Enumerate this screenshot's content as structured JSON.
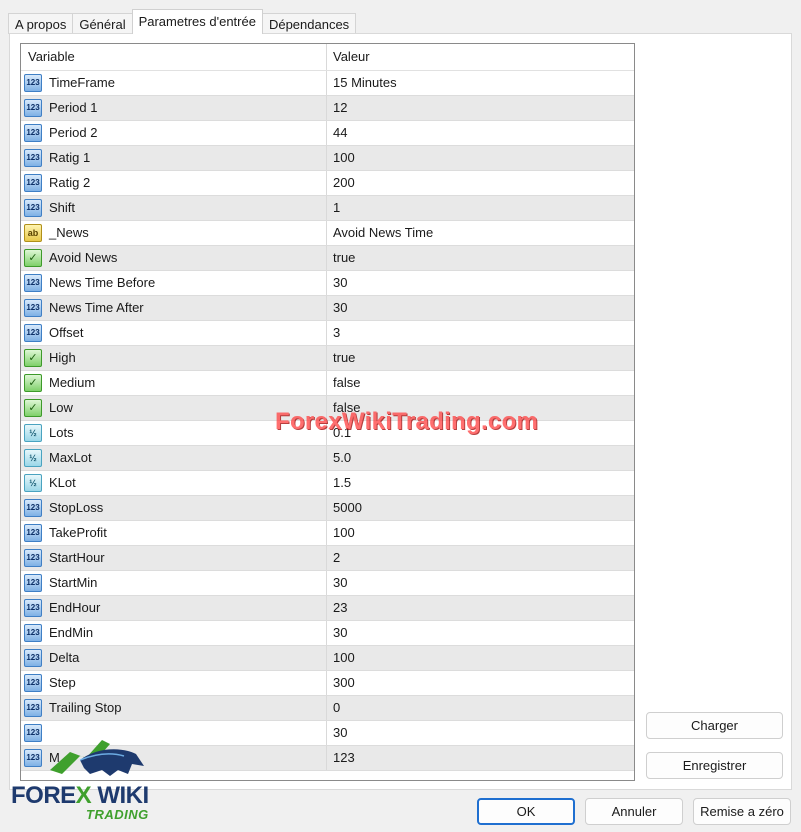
{
  "tabs": [
    {
      "label": "A propos"
    },
    {
      "label": "Général"
    },
    {
      "label": "Parametres d'entrée"
    },
    {
      "label": "Dépendances"
    }
  ],
  "grid": {
    "headers": {
      "variable": "Variable",
      "value": "Valeur"
    },
    "rows": [
      {
        "type": "int",
        "icon": "123",
        "name": "TimeFrame",
        "value": "15 Minutes"
      },
      {
        "type": "int",
        "icon": "123",
        "name": "Period 1",
        "value": "12"
      },
      {
        "type": "int",
        "icon": "123",
        "name": "Period 2",
        "value": "44"
      },
      {
        "type": "int",
        "icon": "123",
        "name": "Ratig 1",
        "value": "100"
      },
      {
        "type": "int",
        "icon": "123",
        "name": "Ratig 2",
        "value": "200"
      },
      {
        "type": "int",
        "icon": "123",
        "name": "Shift",
        "value": "1"
      },
      {
        "type": "str",
        "icon": "ab",
        "name": "_News",
        "value": "Avoid News Time"
      },
      {
        "type": "bool",
        "icon": "✓",
        "name": "Avoid News",
        "value": "true"
      },
      {
        "type": "int",
        "icon": "123",
        "name": "News Time Before",
        "value": "30"
      },
      {
        "type": "int",
        "icon": "123",
        "name": "News Time After",
        "value": "30"
      },
      {
        "type": "int",
        "icon": "123",
        "name": "Offset",
        "value": "3"
      },
      {
        "type": "bool",
        "icon": "✓",
        "name": "High",
        "value": "true"
      },
      {
        "type": "bool",
        "icon": "✓",
        "name": "Medium",
        "value": "false"
      },
      {
        "type": "bool",
        "icon": "✓",
        "name": "Low",
        "value": "false"
      },
      {
        "type": "dbl",
        "icon": "½",
        "name": "Lots",
        "value": "0.1"
      },
      {
        "type": "dbl",
        "icon": "½",
        "name": "MaxLot",
        "value": "5.0"
      },
      {
        "type": "dbl",
        "icon": "½",
        "name": "KLot",
        "value": "1.5"
      },
      {
        "type": "int",
        "icon": "123",
        "name": "StopLoss",
        "value": "5000"
      },
      {
        "type": "int",
        "icon": "123",
        "name": "TakeProfit",
        "value": "100"
      },
      {
        "type": "int",
        "icon": "123",
        "name": "StartHour",
        "value": "2"
      },
      {
        "type": "int",
        "icon": "123",
        "name": "StartMin",
        "value": "30"
      },
      {
        "type": "int",
        "icon": "123",
        "name": "EndHour",
        "value": "23"
      },
      {
        "type": "int",
        "icon": "123",
        "name": "EndMin",
        "value": "30"
      },
      {
        "type": "int",
        "icon": "123",
        "name": "Delta",
        "value": "100"
      },
      {
        "type": "int",
        "icon": "123",
        "name": "Step",
        "value": "300"
      },
      {
        "type": "int",
        "icon": "123",
        "name": "Trailing Stop",
        "value": "0"
      },
      {
        "type": "int",
        "icon": "123",
        "name": "",
        "value": "30"
      },
      {
        "type": "int",
        "icon": "123",
        "name": "M",
        "value": "123"
      }
    ]
  },
  "side_buttons": {
    "load": "Charger",
    "save": "Enregistrer"
  },
  "footer_buttons": {
    "ok": "OK",
    "cancel": "Annuler",
    "reset": "Remise a zéro"
  },
  "watermark": {
    "text": "ForexWikiTrading.com"
  },
  "logo": {
    "word1": "FORE",
    "word_x": "X",
    "word2": "WIKI",
    "sub": "TRADING"
  }
}
